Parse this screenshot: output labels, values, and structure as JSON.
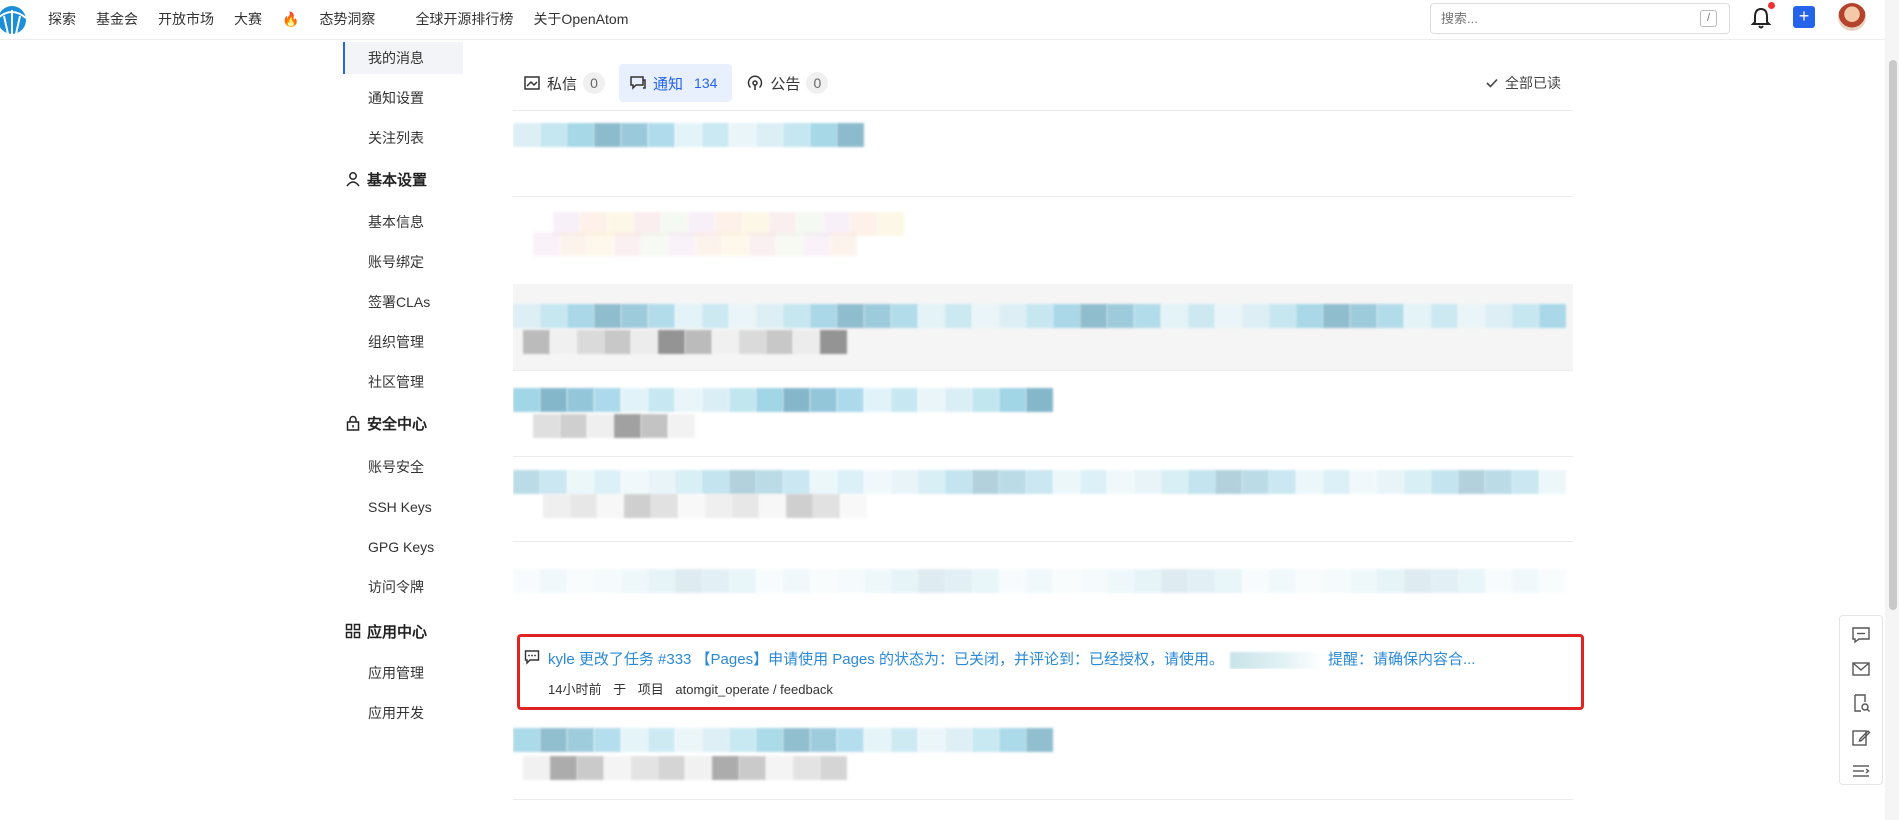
{
  "nav": {
    "items": [
      "探索",
      "基金会",
      "开放市场",
      "大赛",
      "态势洞察",
      "全球开源排行榜",
      "关于OpenAtom"
    ],
    "search_placeholder": "搜索...",
    "slash_hint": "/",
    "plus_label": "+"
  },
  "sidebar": {
    "messages": [
      "我的消息",
      "通知设置",
      "关注列表"
    ],
    "basic_title": "基本设置",
    "basic": [
      "基本信息",
      "账号绑定",
      "签署CLAs",
      "组织管理",
      "社区管理"
    ],
    "security_title": "安全中心",
    "security": [
      "账号安全",
      "SSH Keys",
      "GPG Keys",
      "访问令牌"
    ],
    "app_title": "应用中心",
    "app": [
      "应用管理",
      "应用开发"
    ]
  },
  "tabs": [
    {
      "label": "私信",
      "count": "0",
      "icon": "mail-icon"
    },
    {
      "label": "通知",
      "count": "134",
      "icon": "comment-icon"
    },
    {
      "label": "公告",
      "count": "0",
      "icon": "broadcast-icon"
    }
  ],
  "mark_all_read": "全部已读",
  "highlight": {
    "title": "kyle 更改了任务 #333 【Pages】申请使用 Pages 的状态为：已关闭，并评论到：已经授权，请使用。",
    "title_tail": "提醒：请确保内容合...",
    "time": "14小时前",
    "in": "于",
    "kind": "项目",
    "project": "atomgit_operate / feedback"
  },
  "colors": {
    "accent": "#2563eb",
    "link": "#2b8ad6",
    "highlight_border": "#e02424"
  }
}
